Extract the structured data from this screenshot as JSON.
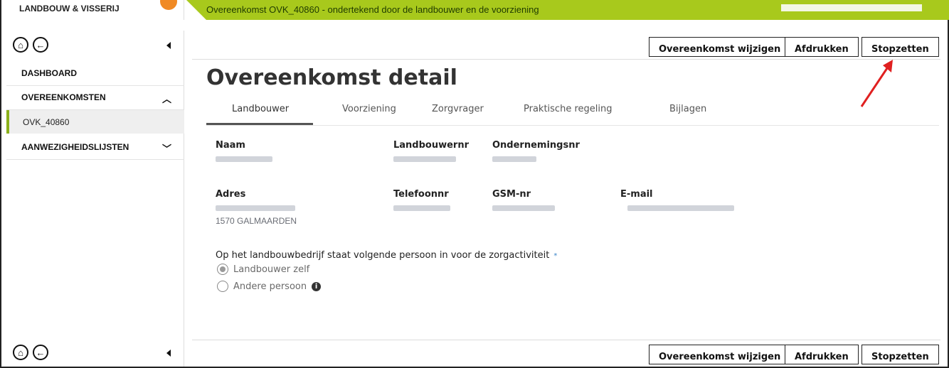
{
  "header": {
    "brand": "LANDBOUW & VISSERIJ",
    "banner_text": "Overeenkomst OVK_40860 - ondertekend door de landbouwer en de voorziening"
  },
  "sidebar": {
    "home_icon": "home-icon",
    "back_icon": "back-arrow-icon",
    "items": [
      {
        "label": "DASHBOARD"
      },
      {
        "label": "OVEREENKOMSTEN",
        "chevron": "^"
      },
      {
        "label": "OVK_40860"
      },
      {
        "label": "AANWEZIGHEIDSLIJSTEN",
        "chevron": "v"
      }
    ]
  },
  "toolbar": {
    "edit_label": "Overeenkomst wijzigen",
    "print_label": "Afdrukken",
    "stop_label": "Stopzetten"
  },
  "main": {
    "title": "Overeenkomst detail",
    "tabs": [
      {
        "label": "Landbouwer",
        "active": true
      },
      {
        "label": "Voorziening"
      },
      {
        "label": "Zorgvrager"
      },
      {
        "label": "Praktische regeling"
      },
      {
        "label": "Bijlagen"
      }
    ],
    "fields": {
      "naam": "Naam",
      "landbouwernr": "Landbouwernr",
      "ondernemingsnr": "Ondernemingsnr",
      "adres": "Adres",
      "adres_line2": "1570 GALMAARDEN",
      "telefoonnr": "Telefoonnr",
      "gsm": "GSM-nr",
      "email": "E-mail"
    },
    "question": "Op het landbouwbedrijf staat volgende persoon in voor de zorgactiviteit",
    "required_marker": "*",
    "options": [
      {
        "label": "Landbouwer zelf",
        "checked": true
      },
      {
        "label": "Andere persoon",
        "checked": false
      }
    ]
  },
  "colors": {
    "banner": "#a8c91c",
    "accent_green": "#8bb01a",
    "arrow_red": "#e02020"
  }
}
